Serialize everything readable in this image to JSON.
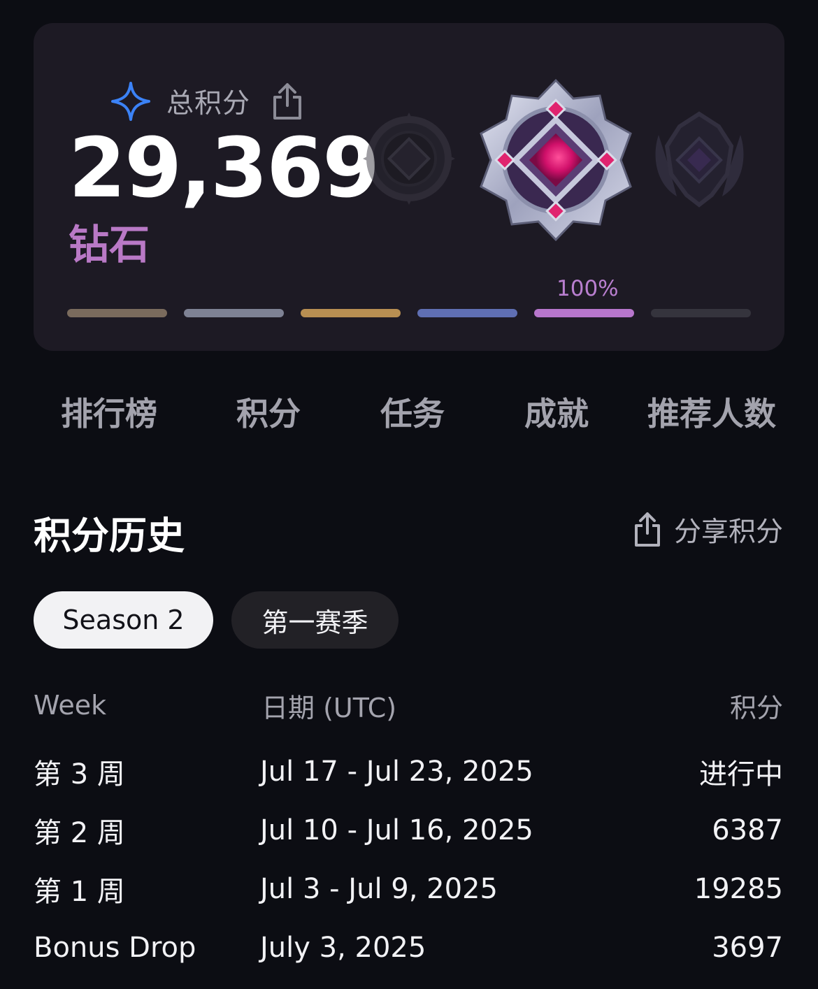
{
  "points_card": {
    "label": "总积分",
    "sparkle_icon": "sparkle-icon",
    "share_icon": "share-icon",
    "total": "29,369",
    "rank": "钻石",
    "progress_label": "100%",
    "progress": 1.0,
    "tier_colors": [
      "#7a6b5d",
      "#7e8294",
      "#b88f52",
      "#5f6fb3",
      "#b776cc",
      "#35343d"
    ]
  },
  "tabs": [
    {
      "label": "排行榜",
      "active": false
    },
    {
      "label": "积分",
      "active": true
    },
    {
      "label": "任务",
      "active": false
    },
    {
      "label": "成就",
      "active": false
    },
    {
      "label": "推荐人数",
      "active": false
    }
  ],
  "history": {
    "title": "积分历史",
    "share_label": "分享积分",
    "seasons": [
      {
        "label": "Season 2",
        "active": true
      },
      {
        "label": "第一赛季",
        "active": false
      }
    ],
    "columns": [
      "Week",
      "日期 (UTC)",
      "积分"
    ],
    "rows": [
      {
        "week": "第 3 周",
        "date": "Jul 17 - Jul 23, 2025",
        "points": "进行中"
      },
      {
        "week": "第 2 周",
        "date": "Jul 10 - Jul 16, 2025",
        "points": "6387"
      },
      {
        "week": "第 1 周",
        "date": "Jul 3 - Jul 9, 2025",
        "points": "19285"
      },
      {
        "week": "Bonus Drop",
        "date": "July 3, 2025",
        "points": "3697"
      }
    ]
  }
}
